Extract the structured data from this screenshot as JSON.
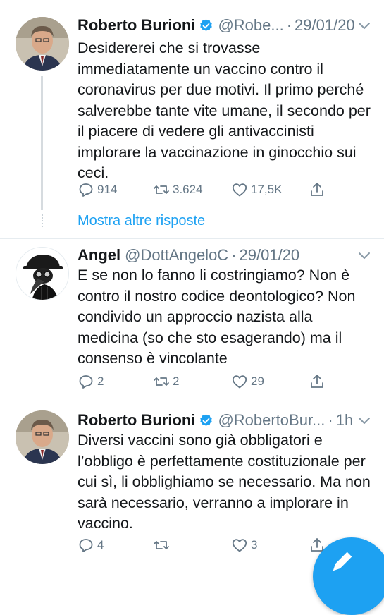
{
  "tweets": [
    {
      "name": "Roberto Burioni",
      "handle": "@Robe...",
      "time": "29/01/20",
      "text": "Desidererei che si trovasse immediatamente un vaccino contro il coronavirus per due motivi. Il primo perché salverebbe tante vite umane, il secondo per il piacere di vedere gli antivaccinisti implorare la vaccinazione in ginocchio sui ceci.",
      "replies": "914",
      "retweets": "3.624",
      "likes": "17,5K",
      "verified": true
    },
    {
      "name": "Angel",
      "handle": "@DottAngeloC",
      "time": "29/01/20",
      "text": "E se non lo fanno li costringiamo? Non è contro il nostro codice deontologico? Non condivido un approccio nazista alla medicina (so che sto esagerando) ma il consenso è vincolante",
      "replies": "2",
      "retweets": "2",
      "likes": "29",
      "verified": false
    },
    {
      "name": "Roberto Burioni",
      "handle": "@RobertoBur...",
      "time": "1h",
      "text": "Diversi vaccini sono già obbligatori e l’obbligo è perfettamente costituzionale per cui sì, li obblighiamo se necessario. Ma non sarà necessario, verranno a implorare in vaccino.",
      "replies": "4",
      "retweets": "",
      "likes": "3",
      "verified": true
    }
  ],
  "more_replies_label": "Mostra altre risposte",
  "colors": {
    "accent": "#1da1f2",
    "muted": "#657786",
    "text": "#14171a"
  },
  "icons": [
    "verified-badge-icon",
    "chevron-down-icon",
    "reply-icon",
    "retweet-icon",
    "like-icon",
    "share-icon",
    "compose-tweet-icon"
  ]
}
